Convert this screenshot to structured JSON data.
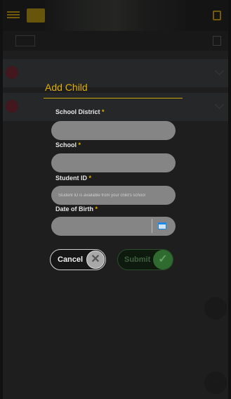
{
  "dialog": {
    "title": "Add Child",
    "fields": {
      "school_district": {
        "label": "School District",
        "required": "*",
        "value": ""
      },
      "school": {
        "label": "School",
        "required": "*",
        "value": ""
      },
      "student_id": {
        "label": "Student ID",
        "required": "*",
        "placeholder": "Student ID is available from your child's school"
      },
      "date_of_birth": {
        "label": "Date of Birth",
        "required": "*",
        "value": ""
      }
    },
    "cancel_label": "Cancel",
    "submit_label": "Submit"
  },
  "icons": {
    "menu": "menu-icon",
    "cancel": "close-icon",
    "submit": "check-icon",
    "calendar": "calendar-icon",
    "add": "plus-icon"
  },
  "colors": {
    "accent": "#e2b100",
    "input_bg": "#858585",
    "submit_green": "#2f6a2f"
  }
}
